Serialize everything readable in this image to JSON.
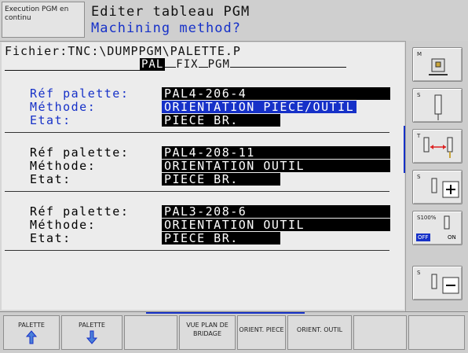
{
  "header": {
    "mode_label": "Execution PGM en continu",
    "title_line1": "Editer tableau PGM",
    "title_line2": "Machining method?"
  },
  "file": {
    "path": "Fichier:TNC:\\DUMPPGM\\PALETTE.P",
    "tabs": [
      "PAL",
      "FIX",
      "PGM"
    ],
    "active_tab": "PAL"
  },
  "pallets": [
    {
      "ref_label": "Réf palette:",
      "ref": "PAL4-206-4",
      "method_label": "Méthode:",
      "method": "ORIENTATION PIECE/OUTIL",
      "state_label": "Etat:",
      "state": "PIECE BR."
    },
    {
      "ref_label": "Réf palette:",
      "ref": "PAL4-208-11",
      "method_label": "Méthode:",
      "method": "ORIENTATION OUTIL",
      "state_label": "Etat:",
      "state": "PIECE BR."
    },
    {
      "ref_label": "Réf palette:",
      "ref": "PAL3-208-6",
      "method_label": "Méthode:",
      "method": "ORIENTATION OUTIL",
      "state_label": "Etat:",
      "state": "PIECE BR."
    }
  ],
  "sidebar": {
    "m_label": "M",
    "s_label": "S",
    "t_label": "T",
    "s_plus_label": "S",
    "override_label": "S100%",
    "off_label": "OFF",
    "on_label": "ON",
    "s_minus_label": "S"
  },
  "softkeys": {
    "k1_label": "PALETTE",
    "k2_label": "PALETTE",
    "k3_label": "",
    "k4_label": "VUE PLAN DE BRIDAGE",
    "k5_label": "ORIENT. PIECE",
    "k6_label": "ORIENT. OUTIL",
    "k7_label": "",
    "k8_label": ""
  },
  "colors": {
    "accent": "#1631c8",
    "background": "#d6d6d6",
    "field": "#000000"
  }
}
